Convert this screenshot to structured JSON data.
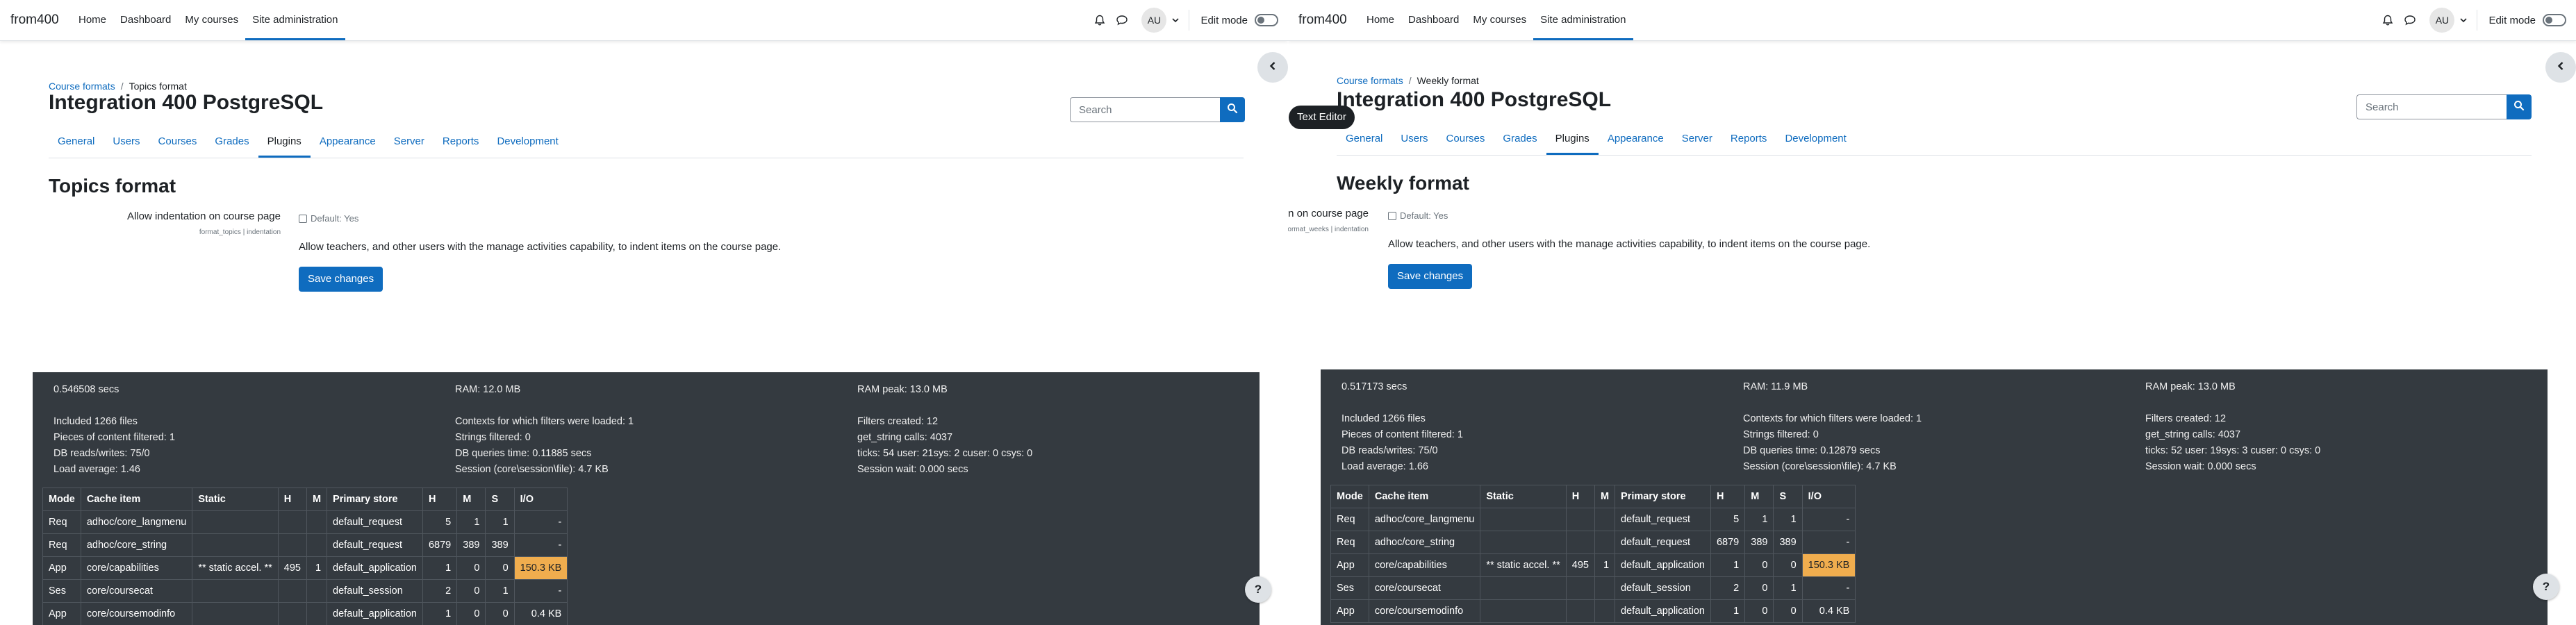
{
  "panes": [
    {
      "brand": "from400",
      "nav": [
        "Home",
        "Dashboard",
        "My courses",
        "Site administration"
      ],
      "avatar": "AU",
      "edit_mode": "Edit mode",
      "breadcrumb": {
        "parent": "Course formats",
        "current": "Topics format"
      },
      "title": "Integration 400 PostgreSQL",
      "search_placeholder": "Search",
      "tabs": [
        "General",
        "Users",
        "Courses",
        "Grades",
        "Plugins",
        "Appearance",
        "Server",
        "Reports",
        "Development"
      ],
      "section_title": "Topics format",
      "setting": {
        "label": "Allow indentation on course page",
        "key": "format_topics | indentation",
        "default": "Default: Yes",
        "description": "Allow teachers, and other users with the manage activities capability, to indent items on the course page."
      },
      "save_label": "Save changes",
      "perf": {
        "col1": [
          "0.546508 secs",
          "",
          "Included 1266 files",
          "Pieces of content filtered: 1",
          "DB reads/writes: 75/0",
          "Load average: 1.46"
        ],
        "col2": [
          "RAM: 12.0 MB",
          "",
          "Contexts for which filters were loaded: 1",
          "Strings filtered: 0",
          "DB queries time: 0.11885 secs",
          "Session (core\\session\\file): 4.7 KB"
        ],
        "col3": [
          "RAM peak: 13.0 MB",
          "",
          "Filters created: 12",
          "get_string calls: 4037",
          "ticks: 54 user: 21sys: 2 cuser: 0 csys: 0",
          "Session wait: 0.000 secs"
        ]
      },
      "table": {
        "headers": [
          "Mode",
          "Cache item",
          "Static",
          "H",
          "M",
          "Primary store",
          "H",
          "M",
          "S",
          "I/O"
        ],
        "rows": [
          [
            "Req",
            "adhoc/core_langmenu",
            "",
            "",
            "",
            "default_request",
            "5",
            "1",
            "1",
            "-"
          ],
          [
            "Req",
            "adhoc/core_string",
            "",
            "",
            "",
            "default_request",
            "6879",
            "389",
            "389",
            "-"
          ],
          [
            "App",
            "core/capabilities",
            "** static accel. **",
            "495",
            "1",
            "default_application",
            "1",
            "0",
            "0",
            "150.3 KB"
          ],
          [
            "Ses",
            "core/coursecat",
            "",
            "",
            "",
            "default_session",
            "2",
            "0",
            "1",
            "-"
          ],
          [
            "App",
            "core/coursemodinfo",
            "",
            "",
            "",
            "default_application",
            "1",
            "0",
            "0",
            "0.4 KB"
          ]
        ]
      }
    },
    {
      "brand": "from400",
      "nav": [
        "Home",
        "Dashboard",
        "My courses",
        "Site administration"
      ],
      "avatar": "AU",
      "edit_mode": "Edit mode",
      "breadcrumb": {
        "parent": "Course formats",
        "current": "Weekly format"
      },
      "title": "Integration 400 PostgreSQL",
      "search_placeholder": "Search",
      "tabs": [
        "General",
        "Users",
        "Courses",
        "Grades",
        "Plugins",
        "Appearance",
        "Server",
        "Reports",
        "Development"
      ],
      "section_title": "Weekly format",
      "setting": {
        "label": "Allow indentation on course page",
        "key": "format_weeks | indentation",
        "default": "Default: Yes",
        "description": "Allow teachers, and other users with the manage activities capability, to indent items on the course page."
      },
      "save_label": "Save changes",
      "perf": {
        "col1": [
          "0.517173 secs",
          "",
          "Included 1266 files",
          "Pieces of content filtered: 1",
          "DB reads/writes: 75/0",
          "Load average: 1.66"
        ],
        "col2": [
          "RAM: 11.9 MB",
          "",
          "Contexts for which filters were loaded: 1",
          "Strings filtered: 0",
          "DB queries time: 0.12879 secs",
          "Session (core\\session\\file): 4.7 KB"
        ],
        "col3": [
          "RAM peak: 13.0 MB",
          "",
          "Filters created: 12",
          "get_string calls: 4037",
          "ticks: 52 user: 19sys: 3 cuser: 0 csys: 0",
          "Session wait: 0.000 secs"
        ]
      },
      "table": {
        "headers": [
          "Mode",
          "Cache item",
          "Static",
          "H",
          "M",
          "Primary store",
          "H",
          "M",
          "S",
          "I/O"
        ],
        "rows": [
          [
            "Req",
            "adhoc/core_langmenu",
            "",
            "",
            "",
            "default_request",
            "5",
            "1",
            "1",
            "-"
          ],
          [
            "Req",
            "adhoc/core_string",
            "",
            "",
            "",
            "default_request",
            "6879",
            "389",
            "389",
            "-"
          ],
          [
            "App",
            "core/capabilities",
            "** static accel. **",
            "495",
            "1",
            "default_application",
            "1",
            "0",
            "0",
            "150.3 KB"
          ],
          [
            "Ses",
            "core/coursecat",
            "",
            "",
            "",
            "default_session",
            "2",
            "0",
            "1",
            "-"
          ],
          [
            "App",
            "core/coursemodinfo",
            "",
            "",
            "",
            "default_application",
            "1",
            "0",
            "0",
            "0.4 KB"
          ]
        ]
      }
    }
  ],
  "tooltip": "Text Editor",
  "help_label": "?",
  "colors": {
    "accent": "#0f6cbf",
    "perf_bg": "#343a40",
    "io_highlight": "#f0ad4e"
  },
  "icons": [
    "bell-icon",
    "chat-icon",
    "chevron-down-icon",
    "search-icon",
    "chevron-left-icon",
    "question-icon"
  ]
}
